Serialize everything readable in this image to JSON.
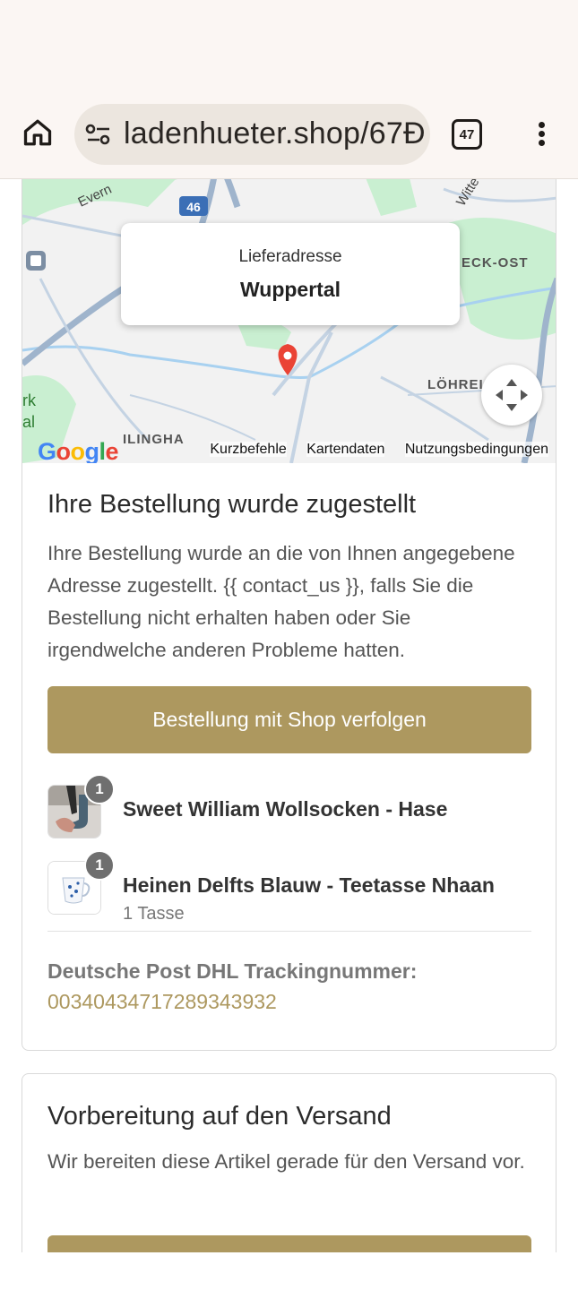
{
  "browser": {
    "url": "ladenhueter.shop/67Ɖ",
    "tab_count": "47"
  },
  "map": {
    "popup_label": "Lieferadresse",
    "popup_city": "Wuppertal",
    "place_labels": [
      "Evern",
      "46",
      "Witte",
      "ECK-OST",
      "LÖHREI",
      "ILINGHA",
      "rk",
      "al"
    ],
    "google_logo": "Google",
    "links": [
      "Kurzbefehle",
      "Kartendaten",
      "Nutzungsbedingungen"
    ],
    "colors": {
      "water": "#a8d1f0",
      "road": "#c4d3e3",
      "park": "#c9efd1",
      "land": "#f2f2f2",
      "pin": "#ea4335"
    }
  },
  "delivered": {
    "title": "Ihre Bestellung wurde zugestellt",
    "description": "Ihre Bestellung wurde an die von Ihnen angegebene Adresse zugestellt. {{ contact_us }}, falls Sie die Bestellung nicht erhalten haben oder Sie irgendwelche anderen Probleme hatten.",
    "track_button": "Bestellung mit Shop verfolgen",
    "items": [
      {
        "name": "Sweet William Wollsocken - Hase",
        "qty": "1",
        "variant": "",
        "icon": "socks-photo"
      },
      {
        "name": "Heinen Delfts Blauw - Teetasse Nhaan",
        "qty": "1",
        "variant": "1 Tasse",
        "icon": "teacup-photo"
      }
    ],
    "tracking_label": "Deutsche Post DHL Trackingnummer:",
    "tracking_number": "00340434717289343932"
  },
  "preparing": {
    "title": "Vorbereitung auf den Versand",
    "description": "Wir bereiten diese Artikel gerade für den Versand vor."
  },
  "theme": {
    "accent": "#ad985f",
    "browser_bg": "#fbf6f3"
  }
}
